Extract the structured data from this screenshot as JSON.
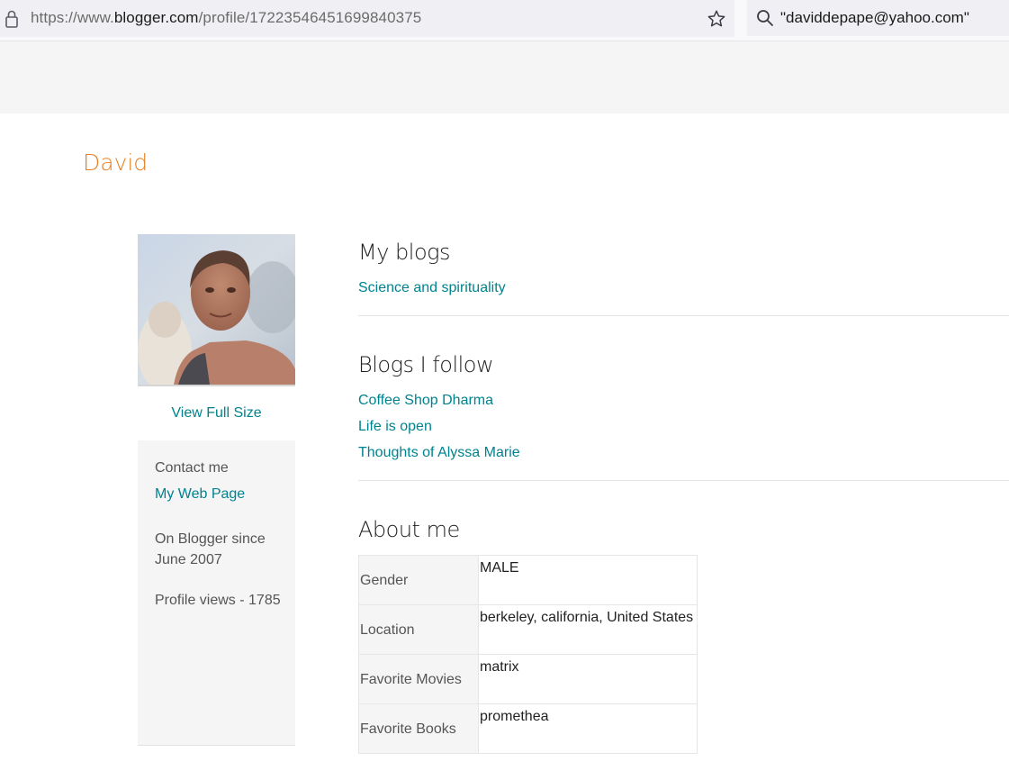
{
  "browser": {
    "url_prefix": "https://www.",
    "url_domain": "blogger.com",
    "url_path": "/profile/17223546451699840375",
    "search_text": "\"daviddepape@yahoo.com\""
  },
  "profile": {
    "name": "David",
    "view_full_size": "View Full Size",
    "contact_label": "Contact me",
    "web_page_link": "My Web Page",
    "on_blogger_since": "On Blogger since June 2007",
    "profile_views": "Profile views - 1785"
  },
  "my_blogs": {
    "heading": "My blogs",
    "items": [
      "Science and spirituality"
    ]
  },
  "blogs_i_follow": {
    "heading": "Blogs I follow",
    "items": [
      "Coffee Shop Dharma",
      "Life is open",
      "Thoughts of Alyssa Marie"
    ]
  },
  "about_me": {
    "heading": "About me",
    "rows": [
      {
        "label": "Gender",
        "value": "MALE"
      },
      {
        "label": "Location",
        "value": "berkeley, california, United States"
      },
      {
        "label": "Favorite Movies",
        "value": "matrix"
      },
      {
        "label": "Favorite Books",
        "value": "promethea"
      }
    ]
  },
  "colors": {
    "name_accent": "#e67e22",
    "link": "#00838f"
  }
}
